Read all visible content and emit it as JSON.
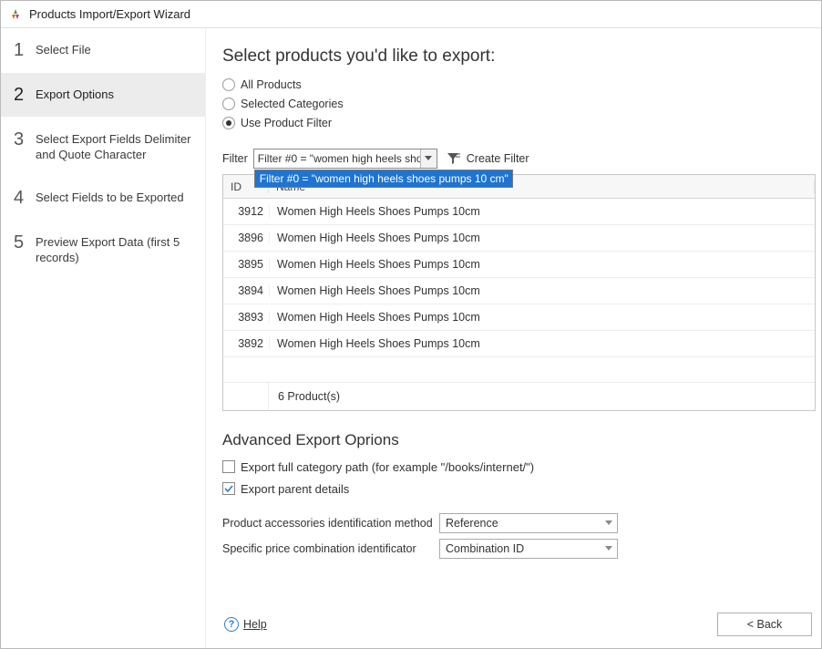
{
  "window": {
    "title": "Products Import/Export Wizard"
  },
  "sidebar": {
    "steps": [
      {
        "num": "1",
        "label": "Select File"
      },
      {
        "num": "2",
        "label": "Export Options"
      },
      {
        "num": "3",
        "label": "Select Export Fields Delimiter and Quote Character"
      },
      {
        "num": "4",
        "label": "Select Fields to be Exported"
      },
      {
        "num": "5",
        "label": "Preview Export Data (first 5 records)"
      }
    ],
    "activeIndex": 1
  },
  "main": {
    "heading": "Select products you'd like to export:",
    "radios": {
      "all": "All Products",
      "categories": "Selected Categories",
      "filter": "Use Product Filter",
      "selected": "filter"
    },
    "filter": {
      "label": "Filter",
      "selectedText": "Filter #0 = \"women high heels shoes",
      "dropdownItem": "Filter #0 =  \"women high heels shoes pumps 10 cm\"",
      "createFilter": "Create Filter"
    },
    "table": {
      "columns": {
        "id": "ID",
        "name": "Name"
      },
      "rows": [
        {
          "id": "3912",
          "name": "Women High Heels Shoes Pumps 10cm"
        },
        {
          "id": "3896",
          "name": "Women High Heels Shoes Pumps 10cm"
        },
        {
          "id": "3895",
          "name": "Women High Heels Shoes Pumps 10cm"
        },
        {
          "id": "3894",
          "name": "Women High Heels Shoes Pumps 10cm"
        },
        {
          "id": "3893",
          "name": "Women High Heels Shoes Pumps 10cm"
        },
        {
          "id": "3892",
          "name": "Women High Heels Shoes Pumps 10cm"
        }
      ],
      "footerCount": "6 Product(s)"
    },
    "advanced": {
      "heading": "Advanced Export Oprions",
      "exportFullPath": {
        "label": "Export full category path (for example \"/books/internet/\")",
        "checked": false
      },
      "exportParent": {
        "label": "Export parent details",
        "checked": true
      },
      "accessories": {
        "label": "Product accessories identification method",
        "value": "Reference"
      },
      "priceCombo": {
        "label": "Specific price combination identificator",
        "value": "Combination ID"
      }
    }
  },
  "footer": {
    "help": "Help",
    "back": "< Back"
  }
}
